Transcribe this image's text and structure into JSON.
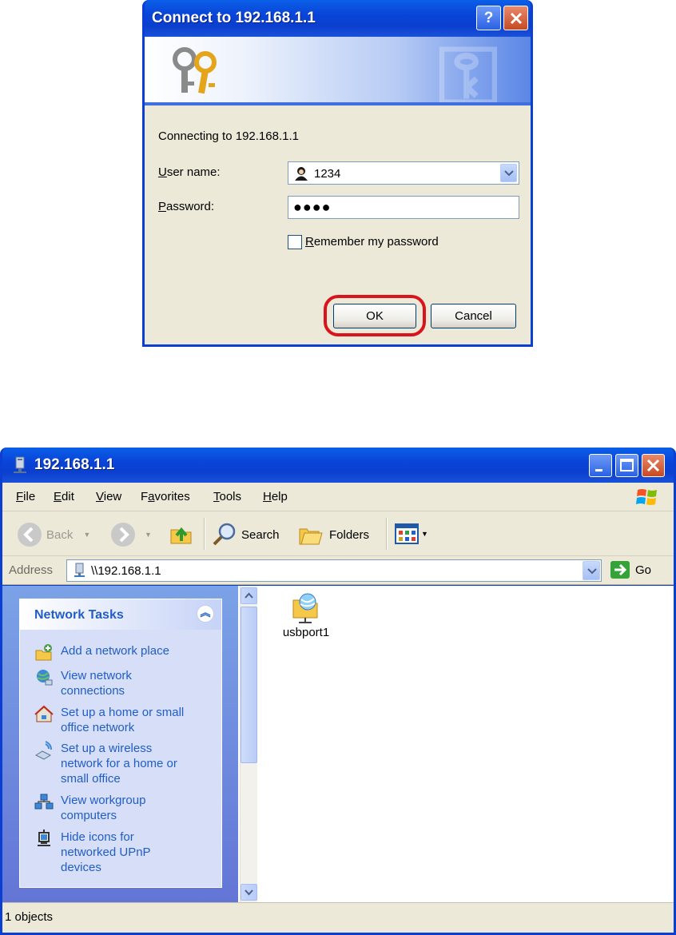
{
  "dialog": {
    "title": "Connect to 192.168.1.1",
    "connecting_text": "Connecting to 192.168.1.1",
    "user_label_u": "U",
    "user_label_rest": "ser name:",
    "password_label_u": "P",
    "password_label_rest": "assword:",
    "username_value": "1234",
    "password_value": "●●●●",
    "remember_u": "R",
    "remember_rest": "emember my password",
    "remember_checked": false,
    "ok_label": "OK",
    "cancel_label": "Cancel",
    "highlight_color": "#d9141d"
  },
  "explorer": {
    "title": "192.168.1.1",
    "menu": [
      {
        "u": "F",
        "rest": "ile"
      },
      {
        "u": "E",
        "rest": "dit"
      },
      {
        "u": "V",
        "rest": "iew"
      },
      {
        "pre": "F",
        "u": "a",
        "rest": "vorites"
      },
      {
        "u": "T",
        "rest": "ools"
      },
      {
        "u": "H",
        "rest": "elp"
      }
    ],
    "toolbar": {
      "back": "Back",
      "search": "Search",
      "folders": "Folders"
    },
    "address_label": "Address",
    "address_value": "\\\\192.168.1.1",
    "go_label": "Go",
    "network_tasks_header": "Network Tasks",
    "tasks": [
      "Add a network place",
      "View network connections",
      "Set up a home or small office network",
      "Set up a wireless network for a home or small office",
      "View workgroup computers",
      "Hide icons for networked UPnP devices"
    ],
    "tasks_lines": [
      [
        "Add a network place"
      ],
      [
        "View network",
        "connections"
      ],
      [
        "Set up a home or small",
        "office network"
      ],
      [
        "Set up a wireless",
        "network for a home or",
        "small office"
      ],
      [
        "View workgroup",
        "computers"
      ],
      [
        "Hide icons for",
        "networked UPnP",
        "devices"
      ]
    ],
    "file_name": "usbport1",
    "status_text": "1 objects"
  }
}
